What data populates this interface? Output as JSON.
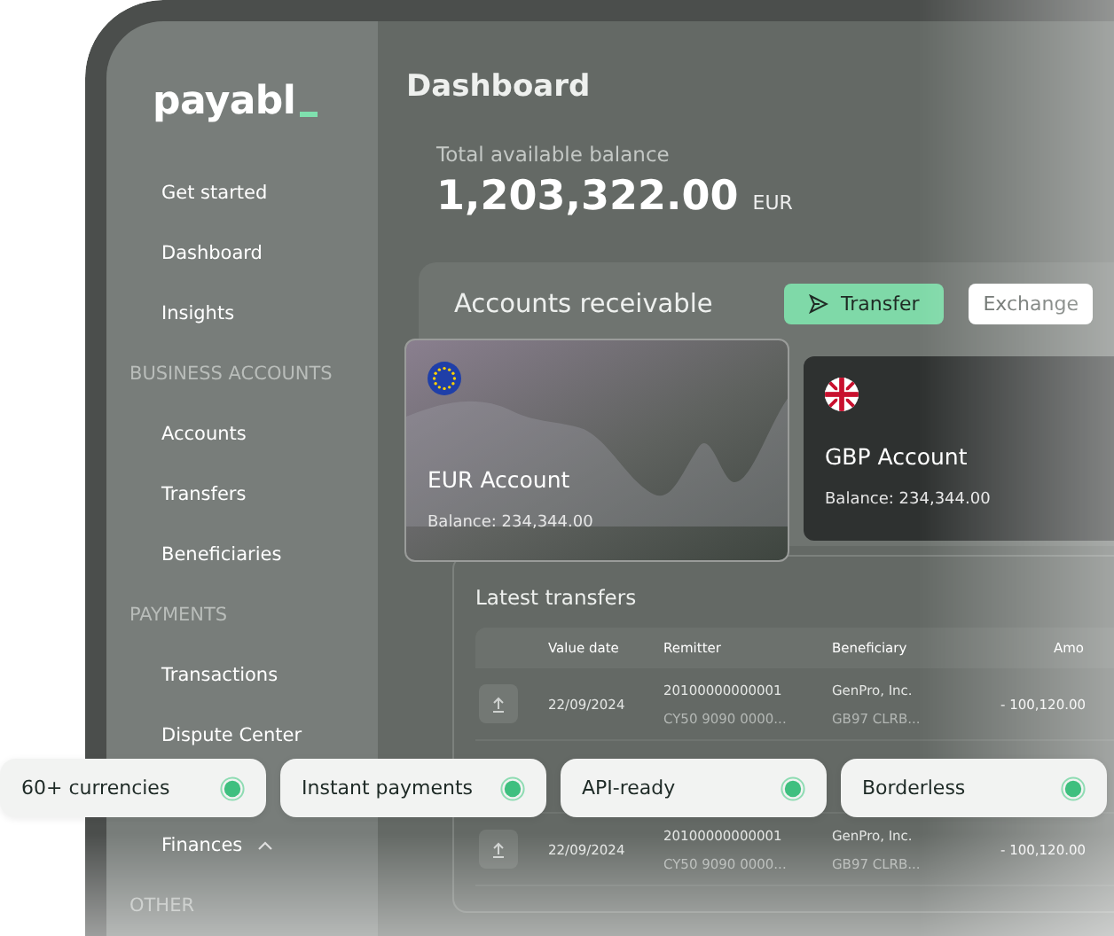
{
  "logo": "payabl",
  "sidebar": {
    "items": [
      {
        "kind": "item",
        "label": "Get started"
      },
      {
        "kind": "item",
        "label": "Dashboard"
      },
      {
        "kind": "item",
        "label": "Insights"
      },
      {
        "kind": "section",
        "label": "BUSINESS ACCOUNTS"
      },
      {
        "kind": "item",
        "label": "Accounts"
      },
      {
        "kind": "item",
        "label": "Transfers"
      },
      {
        "kind": "item",
        "label": "Beneficiaries"
      },
      {
        "kind": "section",
        "label": "PAYMENTS"
      },
      {
        "kind": "item",
        "label": "Transactions"
      },
      {
        "kind": "item",
        "label": "Dispute Center"
      },
      {
        "kind": "group",
        "label": "Finances",
        "expanded": true
      },
      {
        "kind": "section",
        "label": "OTHER"
      }
    ]
  },
  "page_title": "Dashboard",
  "balance": {
    "label": "Total available balance",
    "amount": "1,203,322.00",
    "currency": "EUR"
  },
  "accounts": {
    "title": "Accounts receivable",
    "buttons": [
      {
        "kind": "primary",
        "label": "Transfer"
      },
      {
        "kind": "secondary",
        "label": "Exchange"
      }
    ],
    "cards": [
      {
        "kind": "eu",
        "name": "EUR Account",
        "balance": "Balance: 234,344.00"
      },
      {
        "kind": "gb",
        "name": "GBP Account",
        "balance": "Balance: 234,344.00"
      }
    ]
  },
  "transfers": {
    "title": "Latest transfers",
    "columns": [
      "Value date",
      "Remitter",
      "Beneficiary",
      "Amo"
    ],
    "rows": [
      {
        "date": "22/09/2024",
        "remitter": "20100000000001",
        "remitter_iban": "CY50 9090 0000...",
        "beneficiary": "GenPro, Inc.",
        "beneficiary_iban": "GB97 CLRB...",
        "amount": "- 100,120.00"
      },
      {
        "date": "22/09/2024",
        "remitter": "20100000000001",
        "remitter_iban": "CY50 9090 0000...",
        "beneficiary": "GenPro, Inc.",
        "beneficiary_iban": "GB97 CLRB...",
        "amount": "- 100,120.00"
      }
    ]
  },
  "features": [
    {
      "label": "60+ currencies"
    },
    {
      "label": "Instant payments"
    },
    {
      "label": "API-ready"
    },
    {
      "label": "Borderless"
    }
  ]
}
